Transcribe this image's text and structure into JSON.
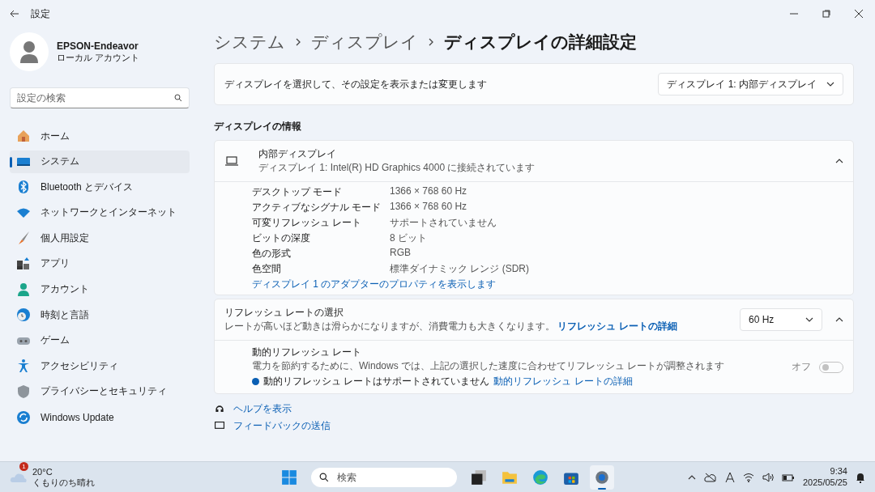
{
  "window": {
    "title": "設定"
  },
  "account": {
    "name": "EPSON-Endeavor",
    "type": "ローカル アカウント"
  },
  "search": {
    "placeholder": "設定の検索"
  },
  "sidebar": {
    "items": [
      {
        "label": "ホーム",
        "selected": false
      },
      {
        "label": "システム",
        "selected": true
      },
      {
        "label": "Bluetooth とデバイス",
        "selected": false
      },
      {
        "label": "ネットワークとインターネット",
        "selected": false
      },
      {
        "label": "個人用設定",
        "selected": false
      },
      {
        "label": "アプリ",
        "selected": false
      },
      {
        "label": "アカウント",
        "selected": false
      },
      {
        "label": "時刻と言語",
        "selected": false
      },
      {
        "label": "ゲーム",
        "selected": false
      },
      {
        "label": "アクセシビリティ",
        "selected": false
      },
      {
        "label": "プライバシーとセキュリティ",
        "selected": false
      },
      {
        "label": "Windows Update",
        "selected": false
      }
    ]
  },
  "breadcrumb": [
    "システム",
    "ディスプレイ",
    "ディスプレイの詳細設定"
  ],
  "display_select": {
    "label": "ディスプレイを選択して、その設定を表示または変更します",
    "value": "ディスプレイ 1: 内部ディスプレイ"
  },
  "section_title": "ディスプレイの情報",
  "display_info": {
    "title": "内部ディスプレイ",
    "subtitle": "ディスプレイ 1: Intel(R) HD Graphics 4000 に接続されています",
    "expanded": true,
    "rows": [
      {
        "label": "デスクトップ モード",
        "value": "1366 × 768 60 Hz"
      },
      {
        "label": "アクティブなシグナル モード",
        "value": "1366 × 768 60 Hz"
      },
      {
        "label": "可変リフレッシュ レート",
        "value": "サポートされていません"
      },
      {
        "label": "ビットの深度",
        "value": "8 ビット"
      },
      {
        "label": "色の形式",
        "value": "RGB"
      },
      {
        "label": "色空間",
        "value": "標準ダイナミック レンジ (SDR)"
      }
    ],
    "link": "ディスプレイ 1 のアダプターのプロパティを表示します"
  },
  "refresh": {
    "title": "リフレッシュ レートの選択",
    "description": "レートが高いほど動きは滑らかになりますが、消費電力も大きくなります。",
    "link": "リフレッシュ レートの詳細",
    "value": "60 Hz",
    "expanded": true,
    "dynamic": {
      "title": "動的リフレッシュ レート",
      "description": "電力を節約するために、Windows では、上記の選択した速度に合わせてリフレッシュ レートが調整されます",
      "note": "動的リフレッシュ レートはサポートされていません",
      "link": "動的リフレッシュ レートの詳細",
      "toggle_label": "オフ",
      "on": false,
      "disabled": true
    }
  },
  "help_links": [
    "ヘルプを表示",
    "フィードバックの送信"
  ],
  "taskbar": {
    "weather": {
      "temp": "20°C",
      "condition": "くもりのち晴れ",
      "badge": "1"
    },
    "search_placeholder": "検索",
    "apps": [
      {
        "selected": false
      },
      {
        "selected": false
      },
      {
        "selected": false
      },
      {
        "selected": false
      },
      {
        "selected": false
      },
      {
        "selected": true
      }
    ],
    "time": "9:34",
    "date": "2025/05/25"
  }
}
